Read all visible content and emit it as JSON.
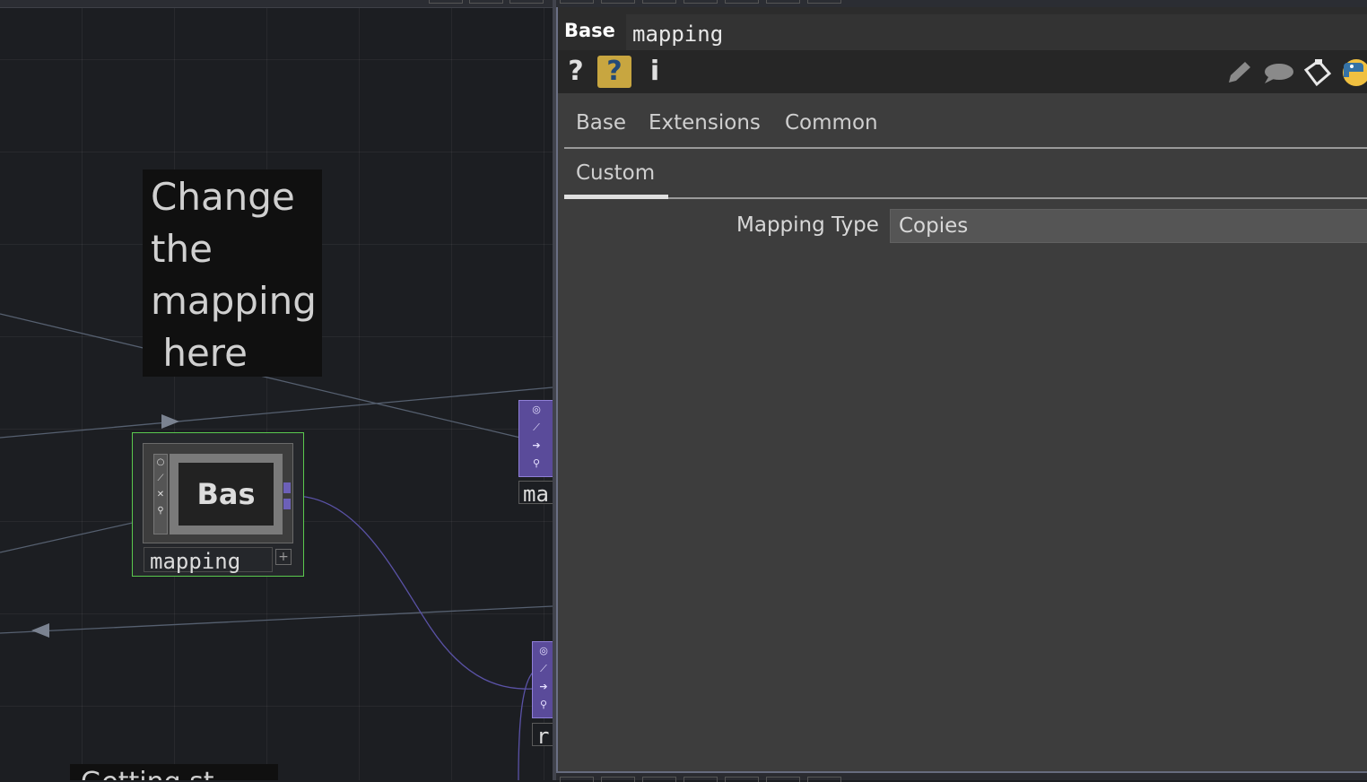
{
  "network": {
    "comment_text": "Change\nthe\nmapping\n here",
    "comment2_text": "Getting st",
    "selected_node": {
      "viewer_text": "Bas",
      "label": "mapping",
      "strip_icons": [
        "viewer-icon",
        "bypass-icon",
        "close-icon",
        "link-icon"
      ]
    },
    "node_a_label": "ma",
    "node_b_label": "r"
  },
  "panel": {
    "op_type": "Base",
    "op_name": "mapping",
    "tools_left": {
      "help": "?",
      "python_help": "?",
      "info": "i"
    },
    "tools_right": [
      "pencil-icon",
      "comment-icon",
      "clipboard-icon",
      "python-icon"
    ],
    "tabs": [
      "Base",
      "Extensions",
      "Common"
    ],
    "custom_tab": "Custom",
    "params": [
      {
        "label": "Mapping Type",
        "value": "Copies"
      }
    ]
  },
  "colors": {
    "selection": "#5ac94e",
    "panel_bg": "#3d3d3d",
    "network_bg": "#1c1e22",
    "purple_node": "#5a4b9a"
  }
}
